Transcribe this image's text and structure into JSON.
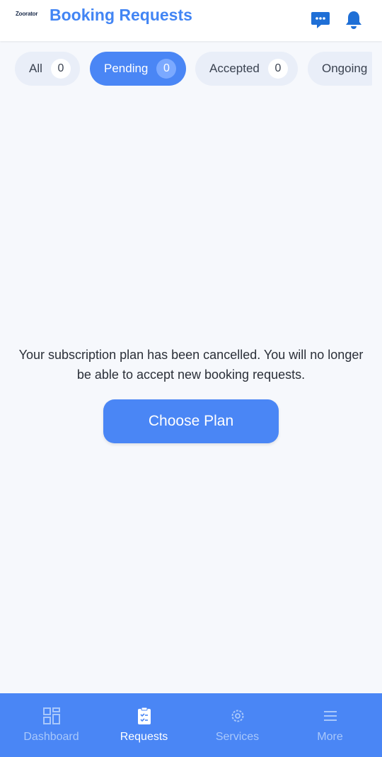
{
  "header": {
    "logo_text": "Zoorator",
    "title": "Booking Requests",
    "icons": [
      "chat-icon",
      "bell-icon"
    ],
    "accent_color": "#4285f4"
  },
  "tabs": [
    {
      "label": "All",
      "count": "0",
      "active": false
    },
    {
      "label": "Pending",
      "count": "0",
      "active": true
    },
    {
      "label": "Accepted",
      "count": "0",
      "active": false
    },
    {
      "label": "Ongoing",
      "count": "",
      "active": false
    }
  ],
  "main": {
    "message": "Your subscription plan has been cancelled. You will no longer be able to accept new booking requests.",
    "button_label": "Choose Plan"
  },
  "bottom_nav": {
    "items": [
      {
        "label": "Dashboard",
        "icon": "dashboard-icon",
        "active": false
      },
      {
        "label": "Requests",
        "icon": "clipboard-icon",
        "active": true
      },
      {
        "label": "Services",
        "icon": "gear-icon",
        "active": false
      },
      {
        "label": "More",
        "icon": "menu-icon",
        "active": false
      }
    ],
    "background_color": "#4a86f5"
  }
}
